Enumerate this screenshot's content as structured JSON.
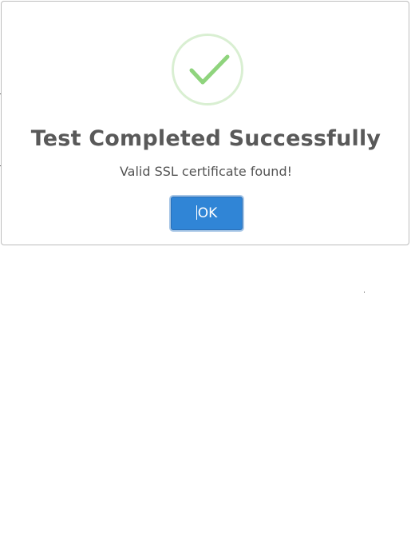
{
  "dialog": {
    "title": "Test Completed Successfully",
    "message": "Valid SSL certificate found!",
    "ok_label": "OK",
    "icon": "success-checkmark-icon"
  },
  "colors": {
    "button": "#3085d6",
    "check": "#8fd47d",
    "icon_ring": "#d9efd2",
    "title_text": "#595959"
  }
}
